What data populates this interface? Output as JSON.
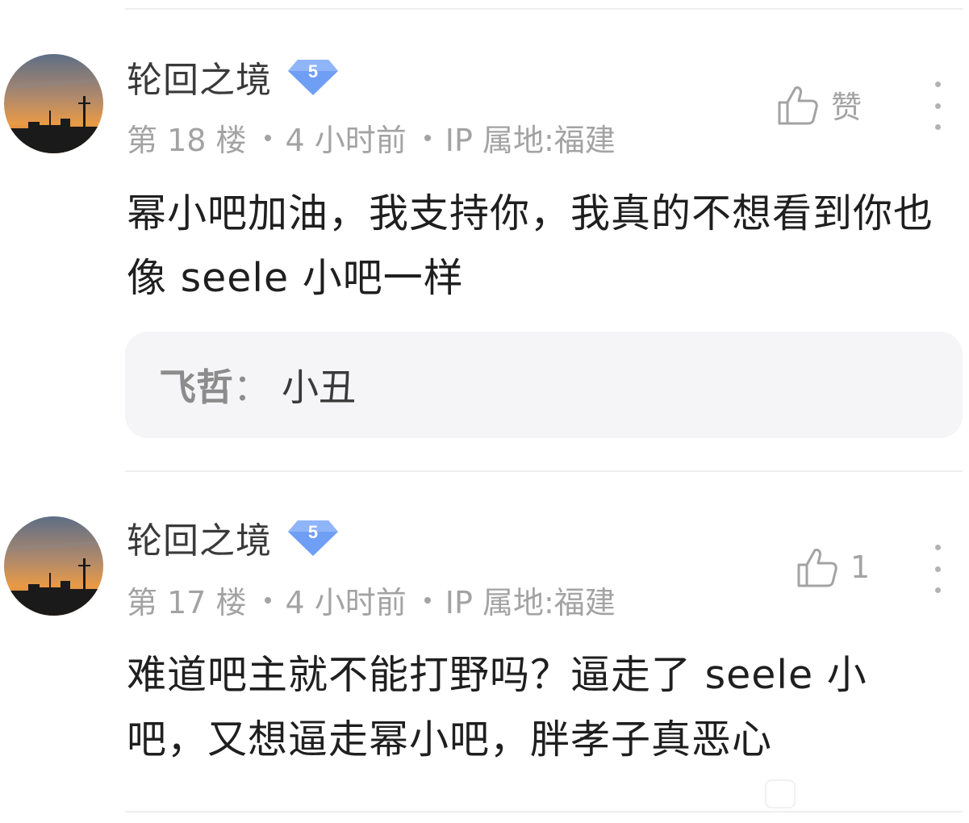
{
  "posts": [
    {
      "username": "轮回之境",
      "level": "5",
      "floor": "第 18 楼",
      "time": "4 小时前",
      "ip": "IP 属地:福建",
      "like_label": "赞",
      "content": "幂小吧加油，我支持你，我真的不想看到你也像 seele 小吧一样",
      "reply": {
        "author": "飞哲",
        "colon": "：",
        "text": "小丑"
      }
    },
    {
      "username": "轮回之境",
      "level": "5",
      "floor": "第 17 楼",
      "time": "4 小时前",
      "ip": "IP 属地:福建",
      "like_label": "1",
      "content": "难道吧主就不能打野吗？逼走了 seele 小吧，又想逼走幂小吧，胖孝子真恶心"
    }
  ],
  "icons": {
    "like": "thumbs-up-icon",
    "more": "more-vertical-icon",
    "level": "level-diamond-icon"
  },
  "colors": {
    "badge": "#6f9ef5",
    "meta_text": "#a3a3a3",
    "reply_bg": "#f5f5f7"
  }
}
